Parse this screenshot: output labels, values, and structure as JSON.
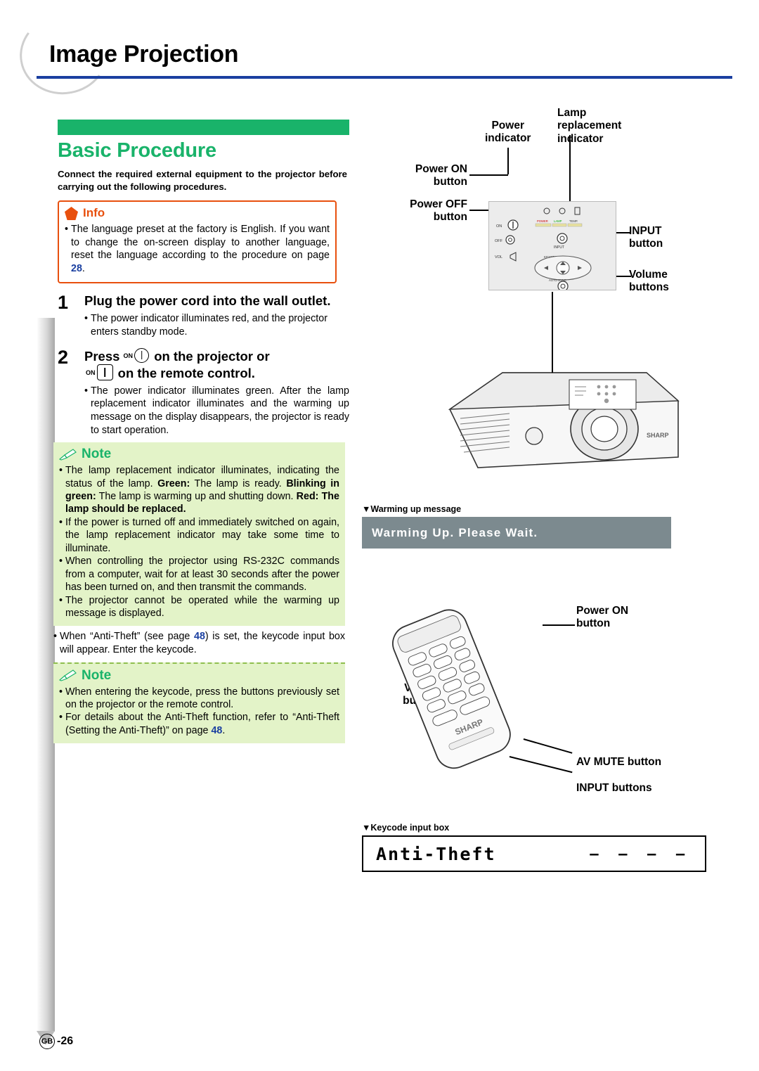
{
  "header": {
    "title": "Image Projection"
  },
  "section": {
    "title": "Basic Procedure",
    "intro": "Connect the required external equipment to the projector before carrying out the following procedures."
  },
  "info": {
    "label": "Info",
    "bullet": "•",
    "text_1": "The language preset at the factory is English.",
    "text_2": "If you want to change the on-screen display to another language, reset the language according to the procedure on page ",
    "page_ref": "28",
    "text_3": "."
  },
  "steps": [
    {
      "number": "1",
      "title": "Plug the power cord into the wall outlet.",
      "bullet": "•",
      "text": "The power indicator illuminates red, and the projector enters standby mode."
    },
    {
      "number": "2",
      "title_a": "Press",
      "on_label": "ON",
      "title_b": "on the projector or",
      "title_c": "on the remote control.",
      "bullet": "•",
      "text": "The power indicator illuminates green. After the lamp replacement indicator illuminates and the warming up message on the display disappears, the projector is ready to start operation."
    }
  ],
  "note1": {
    "label": "Note",
    "bullet": "•",
    "item1_lead": "The lamp replacement indicator illuminates, indicating the status of the lamp.",
    "item1_green_label": "Green:",
    "item1_green_text": "The lamp is ready.",
    "item1_blink_label": "Blinking in green:",
    "item1_blink_text": "The lamp is warming up and shutting down.",
    "item1_red": "Red: The lamp should be replaced.",
    "item2": "If the power is turned off and immediately switched on again, the lamp replacement indicator may take some time to illuminate.",
    "item3": "When controlling the projector using RS-232C commands from a computer, wait for at least 30 seconds after the power has been turned on, and then transmit the commands.",
    "item4": "The projector cannot be operated while the warming up message is displayed."
  },
  "anti_theft_note": {
    "bullet": "•",
    "text_1": "When “Anti-Theft” (see page ",
    "page_ref": "48",
    "text_2": ") is set, the keycode input box will appear. Enter the keycode."
  },
  "note2": {
    "label": "Note",
    "bullet": "•",
    "item1": "When entering the keycode, press the buttons previously set on the projector or the remote control.",
    "item2_1": "For details about the Anti-Theft function, refer to “Anti-Theft (Setting the Anti-Theft)” on page ",
    "item2_page": "48",
    "item2_2": "."
  },
  "callouts": {
    "power_indicator": "Power\nindicator",
    "lamp_replacement_indicator": "Lamp\nreplacement\nindicator",
    "power_on_button": "Power ON\nbutton",
    "power_off_button": "Power OFF\nbutton",
    "input_button": "INPUT\nbutton",
    "volume_buttons": "Volume\nbuttons",
    "remote_power_on": "Power ON\nbutton",
    "remote_volume": "Volume\nbuttons",
    "av_mute": "AV MUTE button",
    "input_buttons": "INPUT buttons"
  },
  "panel_labels": {
    "on": "ON",
    "off": "OFF",
    "vol": "VOL",
    "input": "INPUT",
    "keystone": "KEYSTONE",
    "auto_sync": "AUTO SYNC",
    "power": "POWER",
    "lamp": "LAMP",
    "temp": "TEMP"
  },
  "warming": {
    "caption_arrow": "▼",
    "caption": "Warming up message",
    "message": "Warming Up. Please Wait."
  },
  "keycode": {
    "caption_arrow": "▼",
    "caption": "Keycode input box",
    "title": "Anti-Theft",
    "dashes": "– – – –"
  },
  "footer": {
    "locale": "GB",
    "page": "-26"
  },
  "colors": {
    "green": "#19b36a",
    "orange": "#e8500e",
    "blue": "#1a3fa0",
    "note_bg": "#e3f3c8",
    "message_bg": "#7c8a8f"
  }
}
